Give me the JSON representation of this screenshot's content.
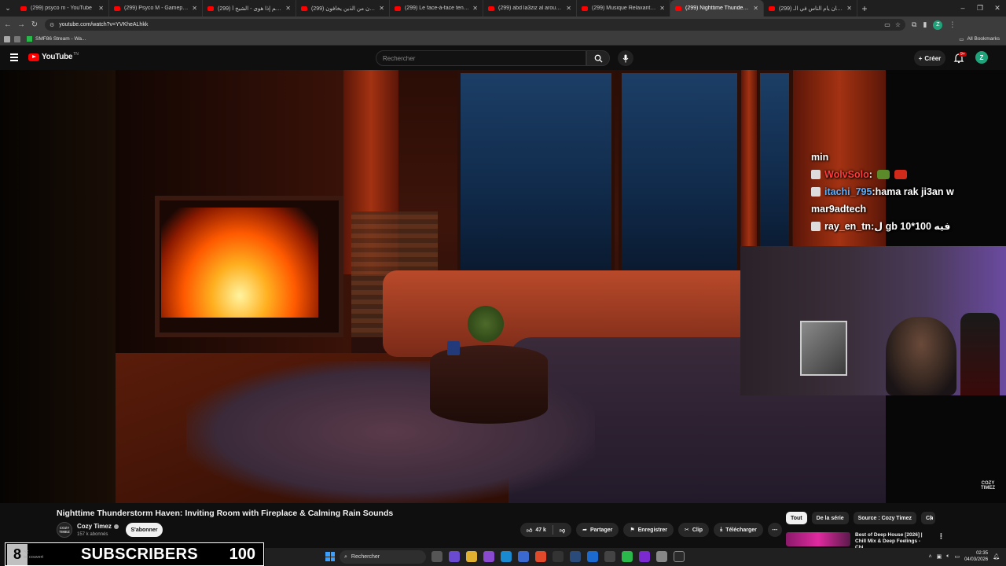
{
  "browser": {
    "tabs": [
      {
        "label": "(299) psyco m - YouTube",
        "active": false
      },
      {
        "label": "(299) Psyco M - Gameplay Strat",
        "active": false
      },
      {
        "label": "(299) و النجم إذا هوى - الشيخ أ...",
        "active": false
      },
      {
        "label": "(299) قال رجلان من الذين يخافون",
        "active": false
      },
      {
        "label": "(299) Le face-à-face tendu entre",
        "active": false
      },
      {
        "label": "(299) abd la3ziz al arousi - You",
        "active": false
      },
      {
        "label": "(299) Musique Relaxante pour",
        "active": false
      },
      {
        "label": "(299) Nighttime Thunderstorm",
        "active": true
      },
      {
        "label": "(299) كيف كان يأم الناس في الـ",
        "active": false
      }
    ],
    "url": "youtube.com/watch?v=YVKheALhkk",
    "bookmark_item": "SMF86 Stream - Wa...",
    "all_bookmarks": "All Bookmarks",
    "profile_letter": "Z"
  },
  "youtube": {
    "logo_text": "YouTube",
    "logo_region": "TN",
    "search_placeholder": "Rechercher",
    "create_label": "Créer",
    "notif_badge": "9+",
    "avatar_letter": "Z"
  },
  "overlay_chat": {
    "line0": "min",
    "messages": [
      {
        "user": "WolvSolo",
        "sep": " :",
        "text": "",
        "user_color": "#ff3a3a"
      },
      {
        "user": "itachi_795",
        "sep": " :",
        "text": " hama rak ji3an w",
        "user_color": "#5ab0ff"
      },
      {
        "continuation": "mar9adtech"
      },
      {
        "user": "ray_en_tn",
        "sep": " :",
        "text": " ل gb 10*100 فيه",
        "user_color": "#ffffff"
      }
    ]
  },
  "video_watermark": {
    "line1": "COZY",
    "line2": "TIMEZ"
  },
  "video": {
    "title": "Nighttime Thunderstorm Haven: Inviting Room with Fireplace & Calming Rain Sounds",
    "channel": "Cozy Timez",
    "channel_avatar_text": "COZY TIMEZ",
    "subscribers": "157 k abonnés",
    "subscribe_label": "S'abonner",
    "likes": "47 k",
    "share_label": "Partager",
    "save_label": "Enregistrer",
    "clip_label": "Clip",
    "download_label": "Télécharger"
  },
  "sidebar": {
    "chips": [
      "Tout",
      "De la série",
      "Source : Cozy Timez",
      "Ch"
    ],
    "rec_title": "Best of Deep House [2026] | Chill Mix & Deep Feelings - Chi..."
  },
  "stream_overlay": {
    "left_number": "8",
    "label": "SUBSCRIBERS",
    "goal": "100",
    "weather": "°C",
    "weather_sub": "iel couvert"
  },
  "taskbar": {
    "search_placeholder": "Rechercher",
    "time": "02:35",
    "date": "04/03/2026"
  }
}
